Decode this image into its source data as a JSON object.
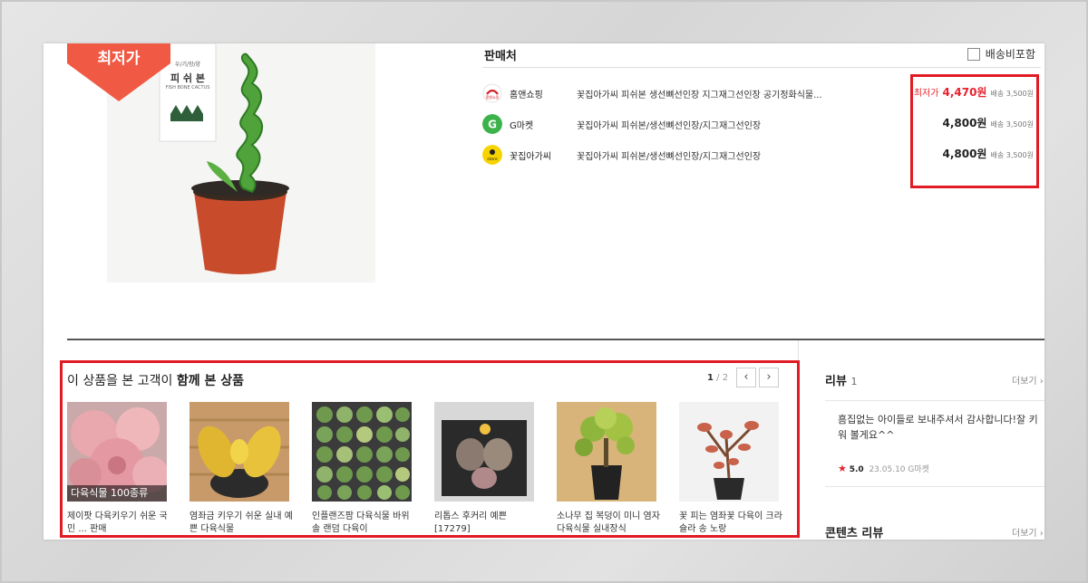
{
  "badge": {
    "label": "최저가"
  },
  "product_image": {
    "pot_tag_line1": "우/기/항/양",
    "pot_tag_name": "피 쉬 본",
    "pot_tag_line2": "FISH BONE CACTUS"
  },
  "seller_table": {
    "title": "판매처",
    "ship_include_label": "배송비포함",
    "rows": [
      {
        "seller": "홈앤쇼핑",
        "product": "꽃집아가씨 피쉬본 생선뼈선인장 지그재그선인장 공기정화식물...",
        "lowest_label": "최저가",
        "price": "4,470원",
        "shipping": "배송 3,500원",
        "logo_color": "#ffffff"
      },
      {
        "seller": "G마켓",
        "product": "꽃집아가씨 피쉬본/생선뼈선인장/지그재그선인장",
        "lowest_label": "",
        "price": "4,800원",
        "shipping": "배송 3,500원",
        "logo_color": "#3cb24a"
      },
      {
        "seller": "꽃집아가씨",
        "product": "꽃집아가씨 피쉬본/생선뼈선인장/지그재그선인장",
        "lowest_label": "",
        "price": "4,800원",
        "shipping": "배송 3,500원",
        "logo_color": "#f7d400"
      }
    ]
  },
  "related": {
    "title_prefix": "이 상품을 본 고객이 ",
    "title_bold": "함께 본 상품",
    "page_current": "1",
    "page_sep": " / ",
    "page_total": "2",
    "prev_icon": "‹",
    "next_icon": "›",
    "items": [
      {
        "caption": "다육식물 100종류",
        "text": "제이팟 다육키우기 쉬운 국민 ... 판매"
      },
      {
        "caption": "",
        "text": "염좌금 키우기 쉬운 실내 예쁜 다육식물"
      },
      {
        "caption": "",
        "text": "인플랜즈팜 다육식물 바위솔 랜덤 다육이"
      },
      {
        "caption": "",
        "text": "리톱스 후커리 예쁜 [17279]"
      },
      {
        "caption": "",
        "text": "소나무 집 복덩이 미니 염자 다육식물 실내장식"
      },
      {
        "caption": "",
        "text": "꽃 피는 염좌꽃 다육이 크라슐라 송 노랑"
      }
    ]
  },
  "reviews": {
    "title": "리뷰",
    "count": "1",
    "more": "더보기 ›",
    "text": "흠집없는 아이들로 보내주셔서 감사합니다!잘 키워 볼게요^^",
    "star": "★",
    "rating": "5.0",
    "date": "23.05.10",
    "source": "G마켓"
  },
  "content_reviews": {
    "title": "콘텐츠 리뷰",
    "more": "더보기 ›"
  },
  "colors": {
    "accent_red": "#e01b24",
    "price_red": "#e8232e",
    "badge_red": "#f05a44"
  }
}
